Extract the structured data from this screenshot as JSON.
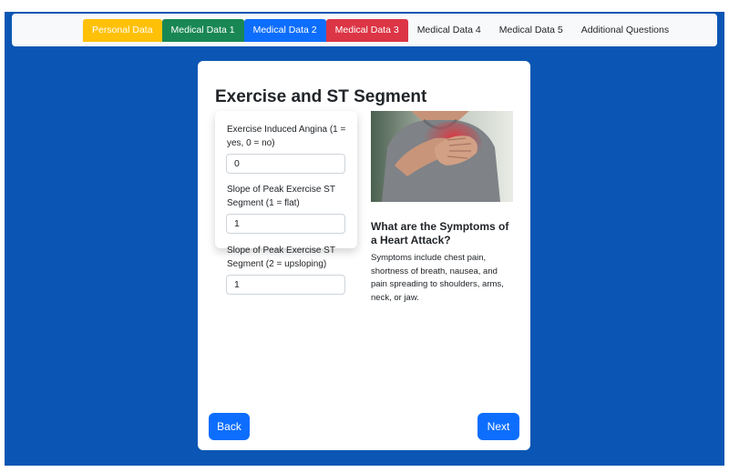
{
  "nav": {
    "tabs": [
      {
        "label": "Personal Data",
        "bg": "#ffc107",
        "color": "#ffffff"
      },
      {
        "label": "Medical Data 1",
        "bg": "#198754",
        "color": "#ffffff"
      },
      {
        "label": "Medical Data 2",
        "bg": "#0d6efd",
        "color": "#ffffff"
      },
      {
        "label": "Medical Data 3",
        "bg": "#dc3545",
        "color": "#ffffff"
      },
      {
        "label": "Medical Data 4",
        "bg": "transparent",
        "color": "#212529"
      },
      {
        "label": "Medical Data 5",
        "bg": "transparent",
        "color": "#212529"
      },
      {
        "label": "Additional Questions",
        "bg": "transparent",
        "color": "#212529"
      }
    ]
  },
  "form": {
    "title": "Exercise and ST Segment",
    "fields": [
      {
        "label": "Exercise Induced Angina (1 = yes, 0 = no)",
        "value": "0"
      },
      {
        "label": "Slope of Peak Exercise ST Segment (1 = flat)",
        "value": "1"
      },
      {
        "label": "Slope of Peak Exercise ST Segment (2 = upsloping)",
        "value": "1"
      }
    ]
  },
  "info": {
    "image_icon": "heart-attack-photo",
    "heading": "What are the Symptoms of a Heart Attack?",
    "text": "Symptoms include chest pain, shortness of breath, nausea, and pain spreading to shoulders, arms, neck, or jaw."
  },
  "buttons": {
    "back": "Back",
    "next": "Next"
  },
  "colors": {
    "background": "#0b56b4",
    "primary": "#0d6efd",
    "navbar": "#f8f9fa"
  }
}
